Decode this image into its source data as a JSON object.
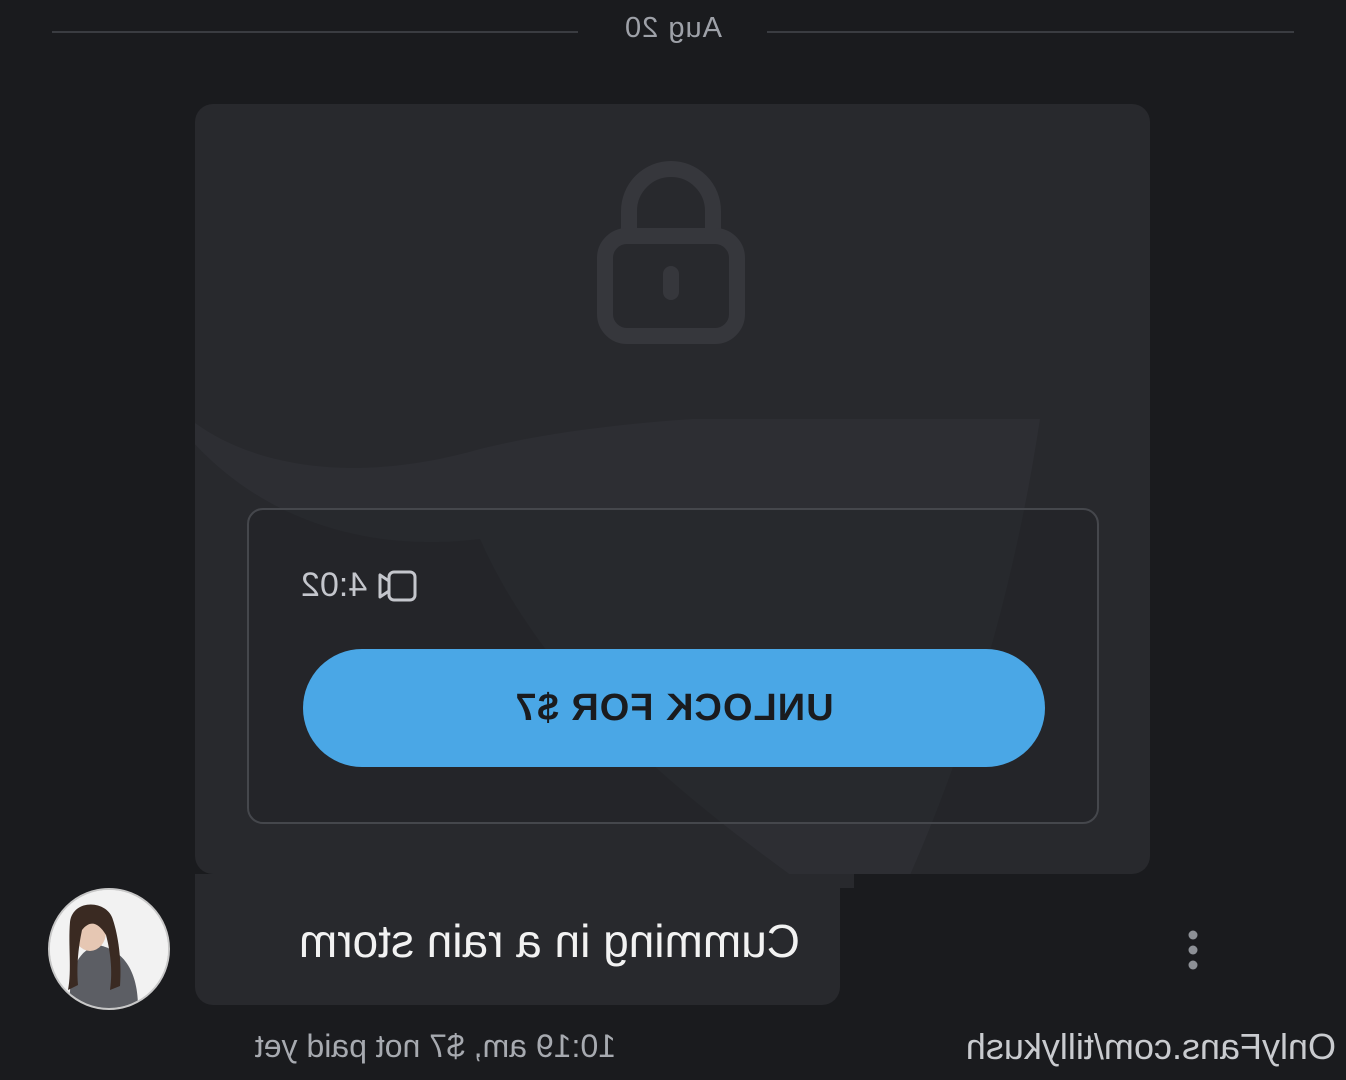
{
  "date_separator": {
    "label": "Aug 20"
  },
  "message": {
    "media": {
      "duration": "4:02",
      "unlock_label": "UNLOCK FOR $7"
    },
    "text": "Cumming in a rain storm",
    "meta": "10:19 am, $7 not paid yet"
  },
  "watermark": "OnlyFans.com/tillykush",
  "icons": [
    "lock-icon",
    "video-camera-icon",
    "more-vertical-icon",
    "avatar"
  ],
  "colors": {
    "background": "#1a1b1e",
    "card": "#28292d",
    "accent": "#4aa7e6",
    "muted_text": "#a7aab0"
  }
}
